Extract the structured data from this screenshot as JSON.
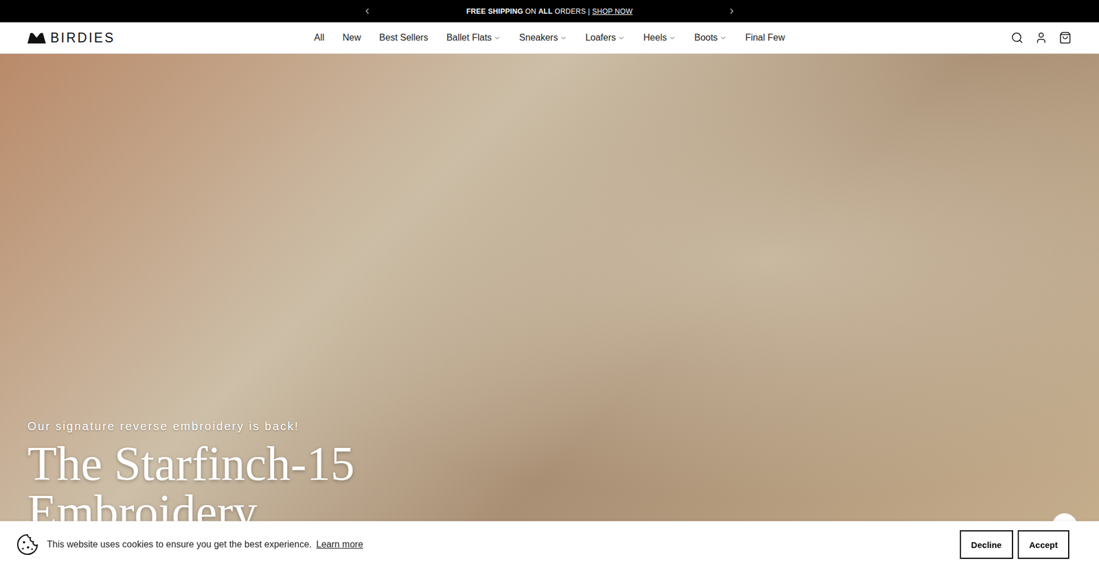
{
  "announcement": {
    "segments": [
      {
        "text": "FREE SHIPPING",
        "bold": true
      },
      {
        "text": " ON ",
        "bold": false
      },
      {
        "text": "ALL",
        "bold": true
      },
      {
        "text": " ORDERS | ",
        "bold": false
      }
    ],
    "link": "SHOP NOW"
  },
  "logo": "BIRDIES",
  "nav": [
    {
      "label": "All",
      "dropdown": false
    },
    {
      "label": "New",
      "dropdown": false
    },
    {
      "label": "Best Sellers",
      "dropdown": false
    },
    {
      "label": "Ballet Flats",
      "dropdown": true
    },
    {
      "label": "Sneakers",
      "dropdown": true
    },
    {
      "label": "Loafers",
      "dropdown": true
    },
    {
      "label": "Heels",
      "dropdown": true
    },
    {
      "label": "Boots",
      "dropdown": true
    },
    {
      "label": "Final Few",
      "dropdown": false
    }
  ],
  "hero": {
    "eyebrow": "Our signature reverse embroidery is back!",
    "title_lines": [
      "The Starfinch-15",
      "Embroidery"
    ]
  },
  "cookie_banner": {
    "message": "This website uses cookies to ensure you get the best experience.",
    "link": "Learn more",
    "buttons": [
      "Decline",
      "Accept"
    ]
  }
}
